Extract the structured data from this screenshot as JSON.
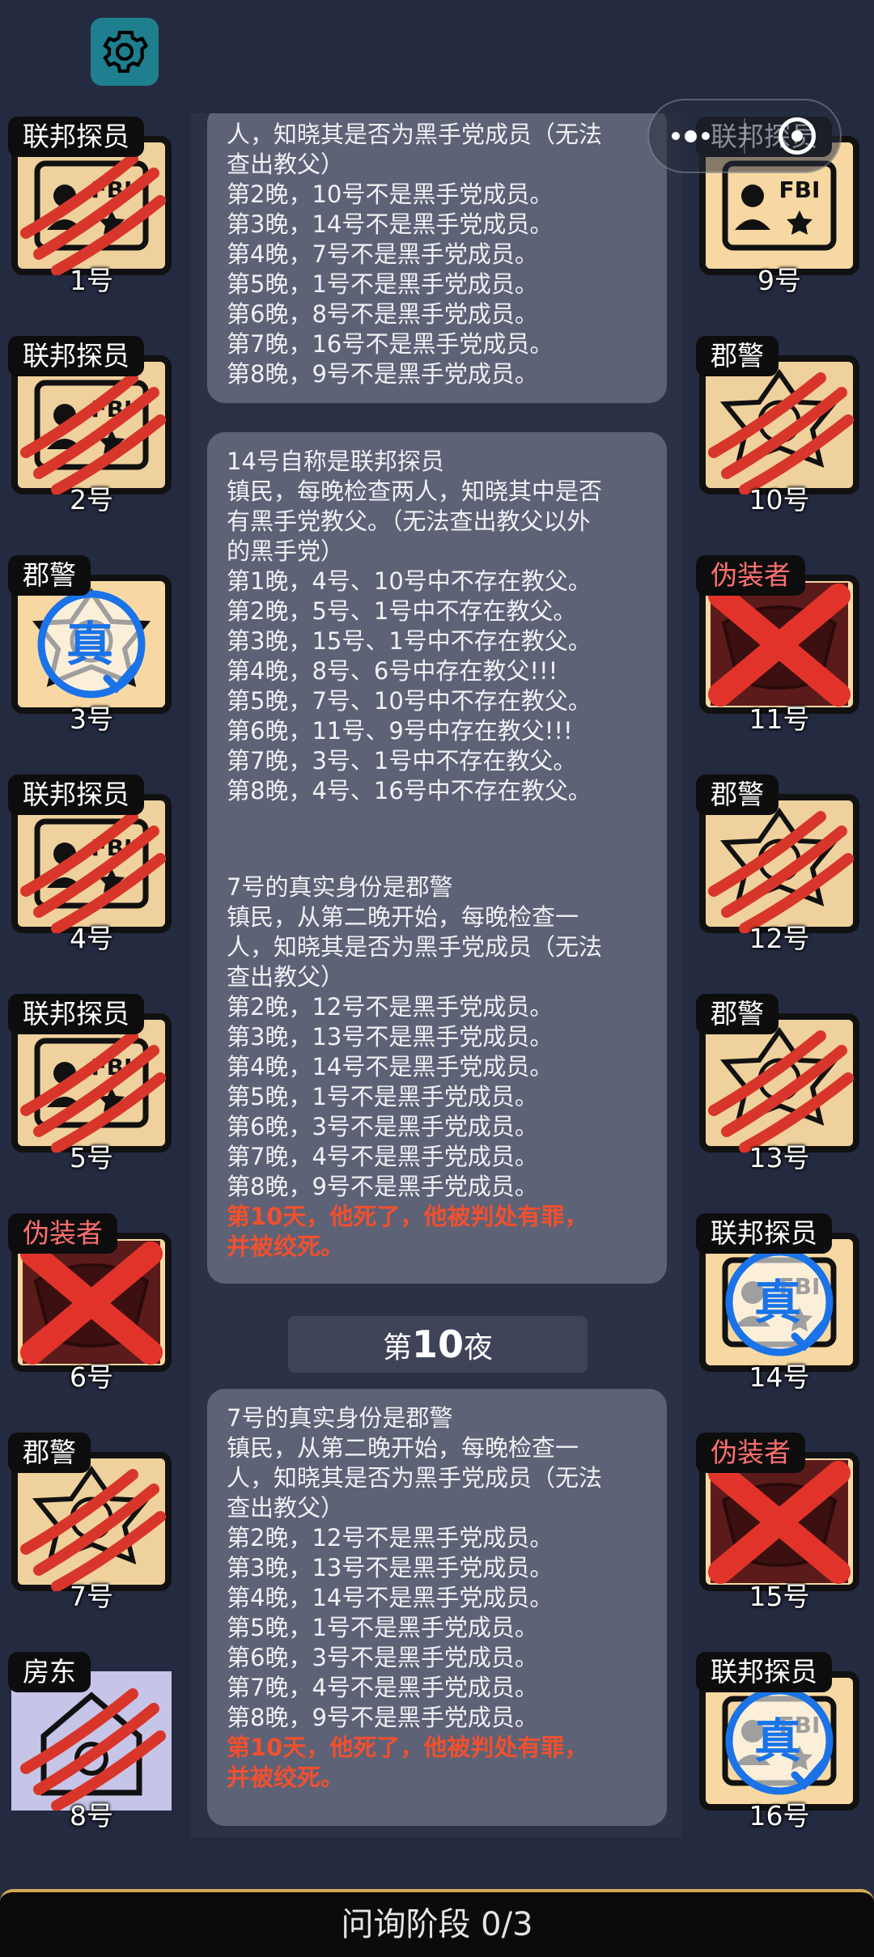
{
  "settings": {
    "icon": "gear-icon"
  },
  "capsule": {
    "menu_icon": "more-dots-icon",
    "close_icon": "close-target-icon"
  },
  "left_players": [
    {
      "role": "联邦探员",
      "number": "1号",
      "status": "dead"
    },
    {
      "role": "联邦探员",
      "number": "2号",
      "status": "dead"
    },
    {
      "role": "郡警",
      "number": "3号",
      "status": "verified"
    },
    {
      "role": "联邦探员",
      "number": "4号",
      "status": "dead"
    },
    {
      "role": "联邦探员",
      "number": "5号",
      "status": "dead"
    },
    {
      "role": "伪装者",
      "number": "6号",
      "status": "eliminated"
    },
    {
      "role": "郡警",
      "number": "7号",
      "status": "dead"
    },
    {
      "role": "房东",
      "number": "8号",
      "status": "dead"
    }
  ],
  "right_players": [
    {
      "role": "联邦探员",
      "number": "9号",
      "status": "alive"
    },
    {
      "role": "郡警",
      "number": "10号",
      "status": "dead"
    },
    {
      "role": "伪装者",
      "number": "11号",
      "status": "eliminated"
    },
    {
      "role": "郡警",
      "number": "12号",
      "status": "dead"
    },
    {
      "role": "郡警",
      "number": "13号",
      "status": "dead"
    },
    {
      "role": "联邦探员",
      "number": "14号",
      "status": "verified"
    },
    {
      "role": "伪装者",
      "number": "15号",
      "status": "eliminated"
    },
    {
      "role": "联邦探员",
      "number": "16号",
      "status": "verified"
    }
  ],
  "badges": {
    "verified_text": "真",
    "fbi_text": "FBI"
  },
  "messages": [
    {
      "lines": [
        "人，知晓其是否为黑手党成员（无法",
        "查出教父）",
        "第2晚，10号不是黑手党成员。",
        "第3晚，14号不是黑手党成员。",
        "第4晚，7号不是黑手党成员。",
        "第5晚，1号不是黑手党成员。",
        "第6晚，8号不是黑手党成员。",
        "第7晚，16号不是黑手党成员。",
        "第8晚，9号不是黑手党成员。"
      ],
      "alert": ""
    },
    {
      "lines": [
        "14号自称是联邦探员",
        "镇民，每晚检查两人，知晓其中是否",
        "有黑手党教父。（无法查出教父以外",
        "的黑手党）",
        "第1晚，4号、10号中不存在教父。",
        "第2晚，5号、1号中不存在教父。",
        "第3晚，15号、1号中不存在教父。",
        "第4晚，8号、6号中存在教父!!!",
        "第5晚，7号、10号中不存在教父。",
        "第6晚，11号、9号中存在教父!!!",
        "第7晚，3号、1号中不存在教父。",
        "第8晚，4号、16号中不存在教父。"
      ],
      "alert": ""
    },
    {
      "lines": [
        "7号的真实身份是郡警",
        "镇民，从第二晚开始，每晚检查一",
        "人，知晓其是否为黑手党成员（无法",
        "查出教父）",
        "第2晚，12号不是黑手党成员。",
        "第3晚，13号不是黑手党成员。",
        "第4晚，14号不是黑手党成员。",
        "第5晚，1号不是黑手党成员。",
        "第6晚，3号不是黑手党成员。",
        "第7晚，4号不是黑手党成员。",
        "第8晚，9号不是黑手党成员。"
      ],
      "alert": "第10天，他死了，他被判处有罪，\n并被绞死。"
    },
    {
      "lines": [
        "7号的真实身份是郡警",
        "镇民，从第二晚开始，每晚检查一",
        "人，知晓其是否为黑手党成员（无法",
        "查出教父）",
        "第2晚，12号不是黑手党成员。",
        "第3晚，13号不是黑手党成员。",
        "第4晚，14号不是黑手党成员。",
        "第5晚，1号不是黑手党成员。",
        "第6晚，3号不是黑手党成员。",
        "第7晚，4号不是黑手党成员。",
        "第8晚，9号不是黑手党成员。"
      ],
      "alert": "第10天，他死了，他被判处有罪，\n并被绞死。"
    }
  ],
  "night": {
    "prefix": "第",
    "number": "10",
    "suffix": "夜"
  },
  "phase": {
    "label": "问询阶段 0/3"
  },
  "colors": {
    "alert": "#f0502f",
    "verified": "#1a73e8",
    "claw": "#d9362b",
    "cross": "#e2332b"
  }
}
